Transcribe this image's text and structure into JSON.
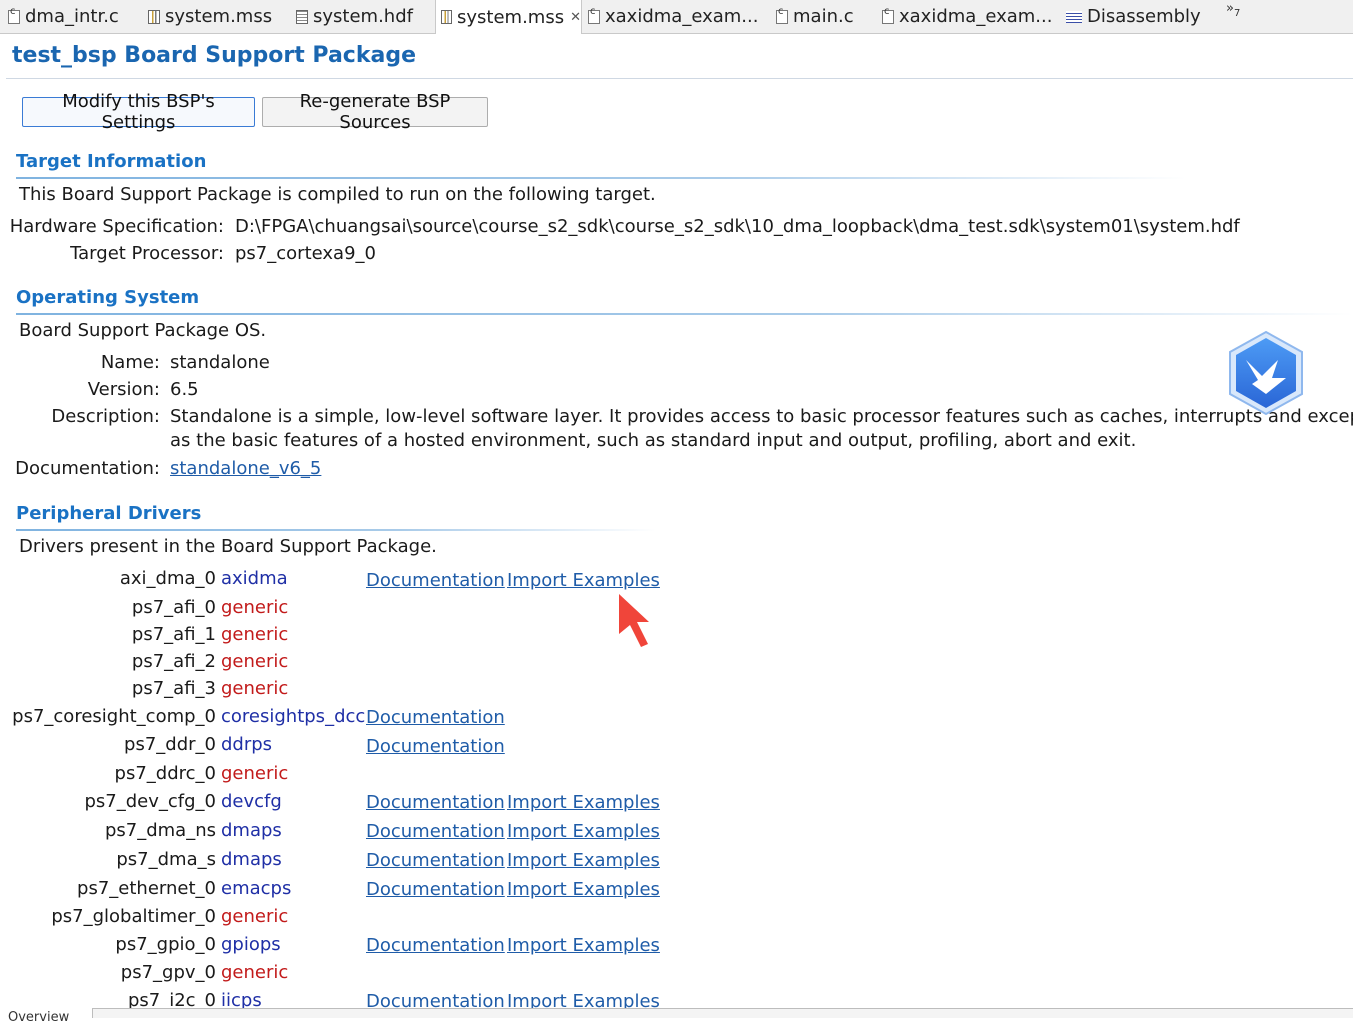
{
  "tabs": [
    {
      "label": "dma_intr.c",
      "icon": "c-file-icon"
    },
    {
      "label": "system.mss",
      "icon": "mss-file-icon"
    },
    {
      "label": "system.hdf",
      "icon": "hdf-file-icon"
    },
    {
      "label": "system.mss",
      "icon": "mss-file-icon",
      "active": true,
      "close": "✕"
    },
    {
      "label": "xaxidma_exam...",
      "icon": "c-file-icon"
    },
    {
      "label": "main.c",
      "icon": "c-file-icon"
    },
    {
      "label": "xaxidma_exam...",
      "icon": "c-file-icon"
    },
    {
      "label": "Disassembly",
      "icon": "disassembly-icon"
    }
  ],
  "tab_overflow": {
    "symbol": "»",
    "count": "7"
  },
  "page_title": "test_bsp Board Support Package",
  "buttons": {
    "modify": "Modify this BSP's Settings",
    "regenerate": "Re-generate BSP Sources"
  },
  "target": {
    "title": "Target Information",
    "intro": "This Board Support Package is compiled to run on the following target.",
    "hw_label": "Hardware Specification:",
    "hw_value": "D:\\FPGA\\chuangsai\\source\\course_s2_sdk\\course_s2_sdk\\10_dma_loopback\\dma_test.sdk\\system01\\system.hdf",
    "proc_label": "Target Processor:",
    "proc_value": "ps7_cortexa9_0"
  },
  "os": {
    "title": "Operating System",
    "intro": "Board Support Package OS.",
    "name_label": "Name:",
    "name_value": "standalone",
    "version_label": "Version:",
    "version_value": "6.5",
    "desc_label": "Description:",
    "desc_line1": "Standalone is a simple, low-level software layer. It provides access to basic processor features such as caches, interrupts and exceptions as w",
    "desc_line2": "as the basic features of a hosted environment, such as standard input and output, profiling, abort and exit.",
    "doc_label": "Documentation:",
    "doc_link": "standalone_v6_5"
  },
  "drivers": {
    "title": "Peripheral Drivers",
    "intro": "Drivers present in the Board Support Package.",
    "doc_link": "Documentation",
    "examples_link": "Import Examples",
    "rows": [
      {
        "instance": "axi_dma_0",
        "driver": "axidma",
        "color": "blue",
        "doc": true,
        "examples": true
      },
      {
        "instance": "ps7_afi_0",
        "driver": "generic",
        "color": "red",
        "doc": false,
        "examples": false
      },
      {
        "instance": "ps7_afi_1",
        "driver": "generic",
        "color": "red",
        "doc": false,
        "examples": false
      },
      {
        "instance": "ps7_afi_2",
        "driver": "generic",
        "color": "red",
        "doc": false,
        "examples": false
      },
      {
        "instance": "ps7_afi_3",
        "driver": "generic",
        "color": "red",
        "doc": false,
        "examples": false
      },
      {
        "instance": "ps7_coresight_comp_0",
        "driver": "coresightps_dcc",
        "color": "blue",
        "doc": true,
        "examples": false
      },
      {
        "instance": "ps7_ddr_0",
        "driver": "ddrps",
        "color": "blue",
        "doc": true,
        "examples": false
      },
      {
        "instance": "ps7_ddrc_0",
        "driver": "generic",
        "color": "red",
        "doc": false,
        "examples": false
      },
      {
        "instance": "ps7_dev_cfg_0",
        "driver": "devcfg",
        "color": "blue",
        "doc": true,
        "examples": true
      },
      {
        "instance": "ps7_dma_ns",
        "driver": "dmaps",
        "color": "blue",
        "doc": true,
        "examples": true
      },
      {
        "instance": "ps7_dma_s",
        "driver": "dmaps",
        "color": "blue",
        "doc": true,
        "examples": true
      },
      {
        "instance": "ps7_ethernet_0",
        "driver": "emacps",
        "color": "blue",
        "doc": true,
        "examples": true
      },
      {
        "instance": "ps7_globaltimer_0",
        "driver": "generic",
        "color": "red",
        "doc": false,
        "examples": false
      },
      {
        "instance": "ps7_gpio_0",
        "driver": "gpiops",
        "color": "blue",
        "doc": true,
        "examples": true
      },
      {
        "instance": "ps7_gpv_0",
        "driver": "generic",
        "color": "red",
        "doc": false,
        "examples": false
      },
      {
        "instance": "ps7_i2c_0",
        "driver": "iicps",
        "color": "blue",
        "doc": true,
        "examples": true
      }
    ]
  },
  "bottom_fragment": "Overview",
  "colors": {
    "title": "#1a66b0",
    "section": "#1a72c4",
    "link": "#1f5ca8",
    "driver_blue": "#1f2fa6",
    "driver_red": "#c21a1a",
    "cursor": "#f0453a",
    "badge": "#3b82e8"
  }
}
